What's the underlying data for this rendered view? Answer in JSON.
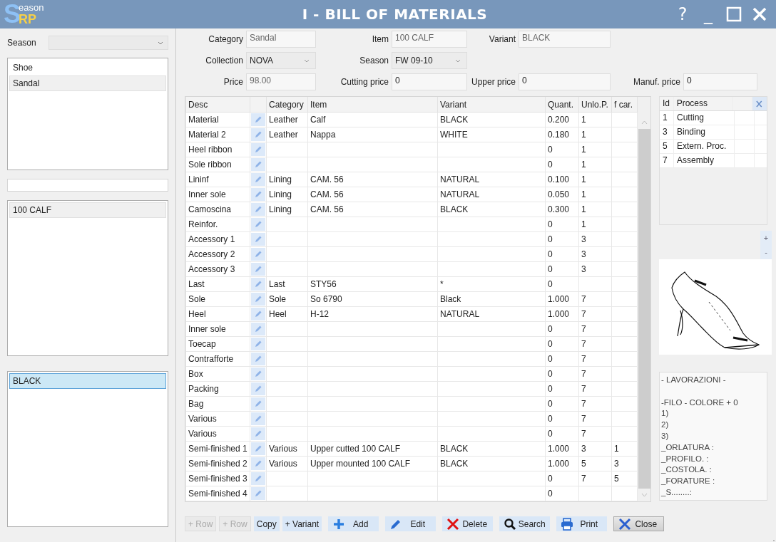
{
  "titlebar": {
    "logo": {
      "big": "S",
      "small": "eason",
      "accent": "RP"
    },
    "title": "I - BILL OF MATERIALS",
    "buttons": [
      {
        "kind": "help",
        "label": "?"
      },
      {
        "kind": "minimize",
        "label": "_"
      },
      {
        "kind": "maximize"
      },
      {
        "kind": "close"
      }
    ]
  },
  "sidebar": {
    "season_label": "Season",
    "categories": [
      {
        "label": "Shoe",
        "selected": false
      },
      {
        "label": "Sandal",
        "selected": true
      }
    ],
    "items": [
      {
        "label": "100 CALF",
        "selected": true
      }
    ],
    "variants": [
      {
        "label": "BLACK",
        "selected": true
      }
    ]
  },
  "form": [
    [
      {
        "label": "Category",
        "value": "Sandal",
        "kind": "readonly"
      },
      {
        "label": "Item",
        "value": "100 CALF",
        "kind": "readonly"
      },
      {
        "label": "Variant",
        "value": "BLACK",
        "kind": "readonly"
      }
    ],
    [
      {
        "label": "Collection",
        "value": "NOVA",
        "kind": "select"
      },
      {
        "label": "Season",
        "value": "FW 09-10",
        "kind": "select"
      }
    ],
    [
      {
        "label": "Price",
        "value": "98.00",
        "kind": "readonly"
      },
      {
        "label": "Cutting price",
        "value": "0",
        "kind": "input"
      },
      {
        "label": "Upper price",
        "value": "0",
        "kind": "input"
      },
      {
        "label": "Manuf. price",
        "value": "0",
        "kind": "input"
      }
    ]
  ],
  "table": {
    "columns": [
      "Desc",
      "",
      "Category",
      "Item",
      "Variant",
      "Quant.",
      "Unlo.P.",
      "f car."
    ],
    "rows": [
      {
        "desc": "Material",
        "category": "Leather",
        "item": "Calf",
        "variant": "BLACK",
        "quant": "0.200",
        "unlop": "1",
        "fcar": ""
      },
      {
        "desc": "Material 2",
        "category": "Leather",
        "item": "Nappa",
        "variant": "WHITE",
        "quant": "0.180",
        "unlop": "1",
        "fcar": ""
      },
      {
        "desc": "Heel ribbon",
        "category": "",
        "item": "",
        "variant": "",
        "quant": "0",
        "unlop": "1",
        "fcar": ""
      },
      {
        "desc": "Sole ribbon",
        "category": "",
        "item": "",
        "variant": "",
        "quant": "0",
        "unlop": "1",
        "fcar": ""
      },
      {
        "desc": "Lininf",
        "category": "Lining",
        "item": "CAM. 56",
        "variant": "NATURAL",
        "quant": "0.100",
        "unlop": "1",
        "fcar": ""
      },
      {
        "desc": "Inner sole",
        "category": "Lining",
        "item": "CAM. 56",
        "variant": "NATURAL",
        "quant": "0.050",
        "unlop": "1",
        "fcar": ""
      },
      {
        "desc": "Camoscina",
        "category": "Lining",
        "item": "CAM. 56",
        "variant": "BLACK",
        "quant": "0.300",
        "unlop": "1",
        "fcar": ""
      },
      {
        "desc": "Reinfor.",
        "category": "",
        "item": "",
        "variant": "",
        "quant": "0",
        "unlop": "1",
        "fcar": ""
      },
      {
        "desc": "Accessory 1",
        "category": "",
        "item": "",
        "variant": "",
        "quant": "0",
        "unlop": "3",
        "fcar": ""
      },
      {
        "desc": "Accessory 2",
        "category": "",
        "item": "",
        "variant": "",
        "quant": "0",
        "unlop": "3",
        "fcar": ""
      },
      {
        "desc": "Accessory 3",
        "category": "",
        "item": "",
        "variant": "",
        "quant": "0",
        "unlop": "3",
        "fcar": ""
      },
      {
        "desc": "Last",
        "category": "Last",
        "item": "STY56",
        "variant": "*",
        "quant": "0",
        "unlop": "",
        "fcar": ""
      },
      {
        "desc": "Sole",
        "category": "Sole",
        "item": "So 6790",
        "variant": "Black",
        "quant": "1.000",
        "unlop": "7",
        "fcar": ""
      },
      {
        "desc": "Heel",
        "category": "Heel",
        "item": "H-12",
        "variant": "NATURAL",
        "quant": "1.000",
        "unlop": "7",
        "fcar": ""
      },
      {
        "desc": "Inner sole",
        "category": "",
        "item": "",
        "variant": "",
        "quant": "0",
        "unlop": "7",
        "fcar": ""
      },
      {
        "desc": "Toecap",
        "category": "",
        "item": "",
        "variant": "",
        "quant": "0",
        "unlop": "7",
        "fcar": ""
      },
      {
        "desc": "Contrafforte",
        "category": "",
        "item": "",
        "variant": "",
        "quant": "0",
        "unlop": "7",
        "fcar": ""
      },
      {
        "desc": "Box",
        "category": "",
        "item": "",
        "variant": "",
        "quant": "0",
        "unlop": "7",
        "fcar": ""
      },
      {
        "desc": "Packing",
        "category": "",
        "item": "",
        "variant": "",
        "quant": "0",
        "unlop": "7",
        "fcar": ""
      },
      {
        "desc": "Bag",
        "category": "",
        "item": "",
        "variant": "",
        "quant": "0",
        "unlop": "7",
        "fcar": ""
      },
      {
        "desc": "Various",
        "category": "",
        "item": "",
        "variant": "",
        "quant": "0",
        "unlop": "7",
        "fcar": ""
      },
      {
        "desc": "Various",
        "category": "",
        "item": "",
        "variant": "",
        "quant": "0",
        "unlop": "7",
        "fcar": ""
      },
      {
        "desc": "Semi-finished 1",
        "category": "Various",
        "item": "Upper cutted 100 CALF",
        "variant": "BLACK",
        "quant": "1.000",
        "unlop": "3",
        "fcar": "1"
      },
      {
        "desc": "Semi-finished 2",
        "category": "Various",
        "item": "Upper mounted 100 CALF",
        "variant": "BLACK",
        "quant": "1.000",
        "unlop": "5",
        "fcar": "3"
      },
      {
        "desc": "Semi-finished 3",
        "category": "",
        "item": "",
        "variant": "",
        "quant": "0",
        "unlop": "7",
        "fcar": "5"
      },
      {
        "desc": "Semi-finished 4",
        "category": "",
        "item": "",
        "variant": "",
        "quant": "0",
        "unlop": "",
        "fcar": ""
      }
    ]
  },
  "process": {
    "columns": [
      "Id",
      "Process"
    ],
    "rows": [
      {
        "id": "1",
        "name": "Cutting"
      },
      {
        "id": "3",
        "name": "Binding"
      },
      {
        "id": "5",
        "name": "Extern. Proc."
      },
      {
        "id": "7",
        "name": "Assembly"
      }
    ],
    "zoom_buttons": [
      "+",
      "-"
    ]
  },
  "notes": "- LAVORAZIONI -\n\n-FILO - COLORE + 0\n1)\n2)\n3)\n_ORLATURA :\n_PROFILO. :\n_COSTOLA. :\n_FORATURE :\n_S........:",
  "buttons": [
    {
      "kind": "plain",
      "label": "+ Row",
      "disabled": true
    },
    {
      "kind": "plain",
      "label": "+ Row",
      "disabled": true
    },
    {
      "kind": "plain",
      "label": "Copy",
      "disabled": false
    },
    {
      "kind": "plain",
      "label": "+ Variant",
      "disabled": false
    },
    {
      "kind": "add",
      "label": "Add",
      "disabled": false
    },
    {
      "kind": "edit",
      "label": "Edit",
      "disabled": false
    },
    {
      "kind": "delete",
      "label": "Delete",
      "disabled": false
    },
    {
      "kind": "search",
      "label": "Search",
      "disabled": false
    },
    {
      "kind": "print",
      "label": "Print",
      "disabled": false
    },
    {
      "kind": "close",
      "label": "Close",
      "disabled": false
    }
  ]
}
